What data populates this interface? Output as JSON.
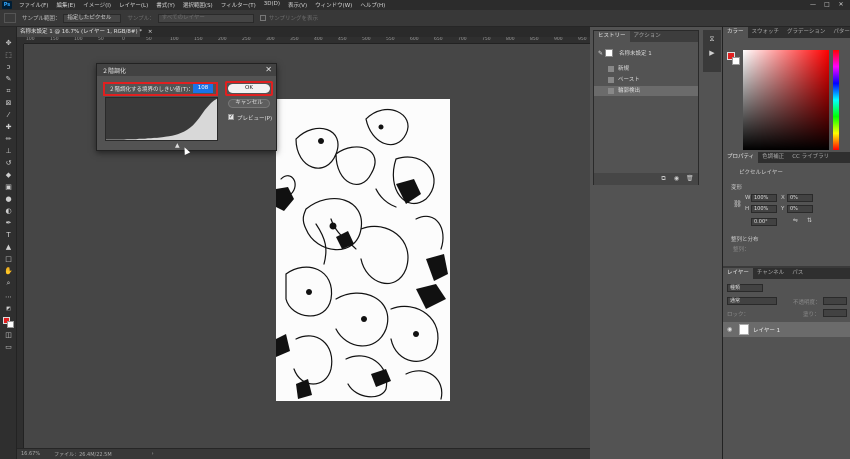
{
  "app": {
    "logo": "Ps",
    "menu": [
      "ファイル(F)",
      "編集(E)",
      "イメージ(I)",
      "レイヤー(L)",
      "書式(Y)",
      "選択範囲(S)",
      "フィルター(T)",
      "3D(D)",
      "表示(V)",
      "ウィンドウ(W)",
      "ヘルプ(H)"
    ],
    "window_controls": [
      "—",
      "□",
      "✕"
    ]
  },
  "options": {
    "sample_range_label": "サンプル範囲：",
    "sample_range_value": "指定したピクセル",
    "sample_label": "サンプル：",
    "sample_value": "すべてのレイヤー",
    "show_ring_label": "サンプリングを表示"
  },
  "document": {
    "tab_label": "名称未設定 1 @ 16.7% (レイヤー 1, RGB/8#) *",
    "tab_close": "×",
    "ruler_ticks": [
      "100",
      "150",
      "100",
      "50",
      "0",
      "50",
      "100",
      "150",
      "200",
      "250",
      "300",
      "350",
      "400",
      "450",
      "500",
      "550",
      "600",
      "650",
      "700",
      "750",
      "800",
      "850",
      "900",
      "950"
    ]
  },
  "status": {
    "zoom": "16.67%",
    "file_info": "ファイル：26.4M/22.5M",
    "arrow": "›"
  },
  "threshold_dialog": {
    "title": "２階調化",
    "close": "✕",
    "threshold_label": "２階調化する境界のしきい値(T)：",
    "threshold_value": "108",
    "ok_label": "OK",
    "cancel_label": "キャンセル",
    "preview_label": "プレビュー(P)",
    "preview_checked": true,
    "histogram_curve": [
      1,
      1,
      1,
      1,
      1,
      1,
      1,
      2,
      2,
      2,
      2,
      3,
      3,
      3,
      4,
      4,
      5,
      5,
      6,
      7,
      8,
      9,
      10,
      12,
      14,
      17,
      20,
      24,
      29,
      35,
      43,
      52,
      62,
      72,
      80,
      88,
      94,
      98
    ]
  },
  "history_panel": {
    "tabs": [
      "ヒストリー",
      "アクション"
    ],
    "snapshot": "名称未設定 1",
    "items": [
      {
        "label": "新規",
        "selected": false
      },
      {
        "label": "ペースト",
        "selected": false
      },
      {
        "label": "輪郭検出",
        "selected": true
      }
    ],
    "footer_icons": [
      "⧉",
      "◉",
      "🗑"
    ]
  },
  "color_panel": {
    "tabs": [
      "カラー",
      "スウォッチ",
      "グラデーション",
      "パターン"
    ],
    "foreground": "#e02020",
    "background": "#ffffff"
  },
  "properties_panel": {
    "tabs": [
      "プロパティ",
      "色調補正",
      "CC ライブラリ"
    ],
    "layer_type": "ピクセルレイヤー",
    "section_transform": "変形",
    "w_label": "W",
    "w_value": "100%",
    "h_label": "H",
    "h_value": "100%",
    "x_label": "X",
    "x_value": "0%",
    "y_label": "Y",
    "y_value": "0%",
    "angle_value": "0.00°",
    "section_align": "整列と分布",
    "align_sub": "整列："
  },
  "layers_panel": {
    "tabs": [
      "レイヤー",
      "チャンネル",
      "パス"
    ],
    "kind_filter": "種類",
    "blend_mode": "通常",
    "opacity_label": "不透明度：",
    "lock_label": "ロック：",
    "fill_label": "塗り：",
    "layer_name": "レイヤー 1"
  },
  "colors": {
    "highlight_red": "#e02020",
    "input_blue": "#1a73e8",
    "ps_blue": "#31a8ff"
  }
}
